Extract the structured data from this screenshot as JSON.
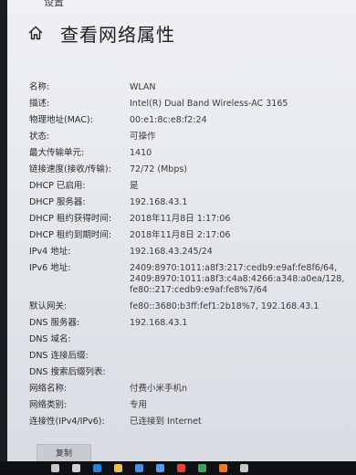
{
  "window": {
    "partial_title": "设置"
  },
  "header": {
    "title": "查看网络属性",
    "home_icon": "home-icon"
  },
  "properties": [
    {
      "key": "名称:",
      "value": "WLAN"
    },
    {
      "key": "描述:",
      "value": "Intel(R) Dual Band Wireless-AC 3165"
    },
    {
      "key": "物理地址(MAC):",
      "value": "00:e1:8c:e8:f2:24"
    },
    {
      "key": "状态:",
      "value": "可操作"
    },
    {
      "key": "最大传输单元:",
      "value": "1410"
    },
    {
      "key": "链接速度(接收/传输):",
      "value": "72/72 (Mbps)"
    },
    {
      "key": "DHCP 已启用:",
      "value": "是"
    },
    {
      "key": "DHCP 服务器:",
      "value": "192.168.43.1"
    },
    {
      "key": "DHCP 租约获得时间:",
      "value": "2018年11月8日 1:17:06"
    },
    {
      "key": "DHCP 租约到期时间:",
      "value": "2018年11月8日 2:17:06"
    },
    {
      "key": "IPv4 地址:",
      "value": "192.168.43.245/24"
    },
    {
      "key": "IPv6 地址:",
      "value": "2409:8970:1011:a8f3:217:cedb9:e9af:fe8f6/64,\n2409:8970:1011:a8f3:c4a8:4266:a348:a0ea/128, fe80::217:cedb9:e9af:fe8%7/64"
    },
    {
      "key": "默认网关:",
      "value": "fe80::3680:b3ff:fef1:2b18%7, 192.168.43.1"
    },
    {
      "key": "DNS 服务器:",
      "value": "192.168.43.1"
    },
    {
      "key": "DNS 域名:",
      "value": ""
    },
    {
      "key": "DNS 连接后缀:",
      "value": ""
    },
    {
      "key": "DNS 搜索后缀列表:",
      "value": ""
    },
    {
      "key": "网络名称:",
      "value": "付费小米手机n"
    },
    {
      "key": "网络类别:",
      "value": "专用"
    },
    {
      "key": "连接性(IPv4/IPv6):",
      "value": "已连接到 Internet"
    }
  ],
  "actions": {
    "copy_label": "复制"
  },
  "taskbar": {
    "icons": [
      {
        "name": "search-icon",
        "color": "#c8c8c8"
      },
      {
        "name": "task-view-icon",
        "color": "#d0d0d0"
      },
      {
        "name": "edge-icon",
        "color": "#2f7fd8"
      },
      {
        "name": "explorer-icon",
        "color": "#e8c04a"
      },
      {
        "name": "store-icon",
        "color": "#4a8fe0"
      },
      {
        "name": "mail-icon",
        "color": "#5a9be8"
      },
      {
        "name": "app-icon",
        "color": "#d84a3a"
      },
      {
        "name": "app-icon",
        "color": "#3fa55a"
      },
      {
        "name": "app-icon",
        "color": "#e87a2a"
      },
      {
        "name": "app-icon",
        "color": "#c8c8c8"
      }
    ]
  }
}
